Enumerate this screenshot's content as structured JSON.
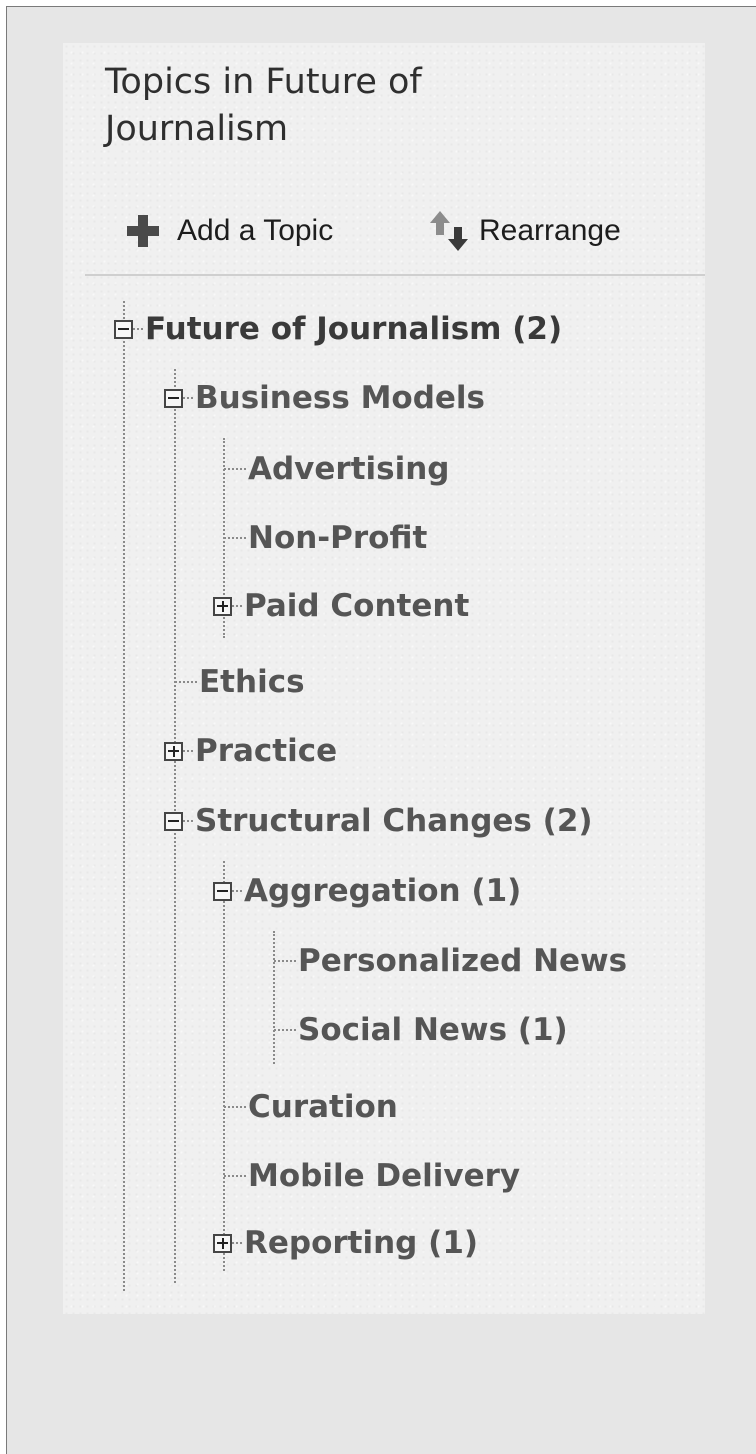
{
  "panel": {
    "title": "Topics in Future of Journalism"
  },
  "toolbar": {
    "add_topic_label": "Add a Topic",
    "add_topic_icon": "plus-icon",
    "rearrange_label": "Rearrange",
    "rearrange_icon": "up-down-arrows-icon"
  },
  "tree": {
    "root": {
      "label": "Future of Journalism (2)",
      "state": "expanded"
    },
    "business_models": {
      "label": "Business Models",
      "state": "expanded"
    },
    "advertising": {
      "label": "Advertising",
      "state": "leaf"
    },
    "non_profit": {
      "label": "Non-Profit",
      "state": "leaf"
    },
    "paid_content": {
      "label": "Paid Content",
      "state": "collapsed"
    },
    "ethics": {
      "label": "Ethics",
      "state": "leaf"
    },
    "practice": {
      "label": "Practice",
      "state": "collapsed"
    },
    "structural_changes": {
      "label": "Structural Changes (2)",
      "state": "expanded"
    },
    "aggregation": {
      "label": "Aggregation (1)",
      "state": "expanded"
    },
    "personalized_news": {
      "label": "Personalized News",
      "state": "leaf"
    },
    "social_news": {
      "label": "Social News (1)",
      "state": "leaf"
    },
    "curation": {
      "label": "Curation",
      "state": "leaf"
    },
    "mobile_delivery": {
      "label": "Mobile Delivery",
      "state": "leaf"
    },
    "reporting": {
      "label": "Reporting (1)",
      "state": "collapsed"
    }
  },
  "colors": {
    "background": "#e6e6e6",
    "panel": "#f0f0f0",
    "root_text": "#3a3a3a",
    "child_text": "#555555",
    "connector": "#8a8a8a"
  }
}
